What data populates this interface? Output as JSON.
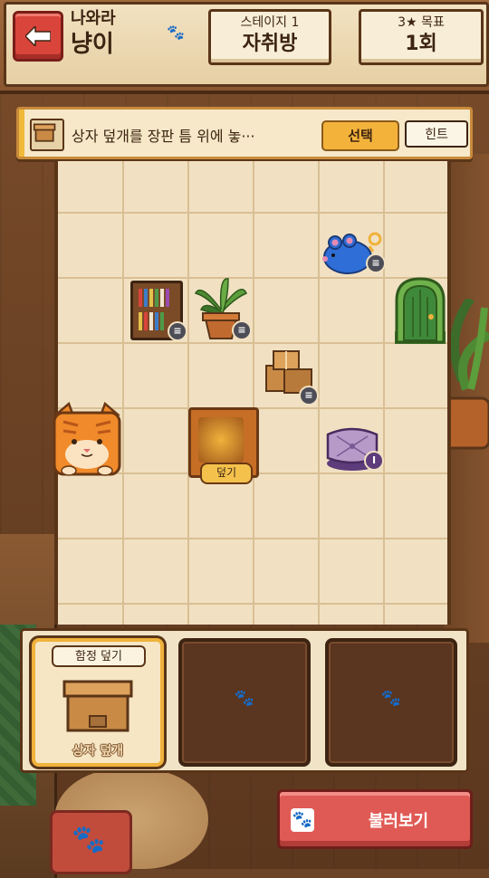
{
  "header": {
    "title_line1": "나와라",
    "title_line2": "냥이",
    "stage": {
      "label": "스테이지 1",
      "value": "자취방"
    },
    "goal": {
      "label": "3★ 목표",
      "value": "1회"
    }
  },
  "hint_bar": {
    "text": "상자 덮개를 장판 틈 위에 놓···",
    "select_label": "선택",
    "hint_label": "힌트"
  },
  "board": {
    "trap_label": "덮기",
    "badge_glyph": "≡",
    "cushion_badge_glyph": "I"
  },
  "inventory": {
    "slots": [
      {
        "title": "함정 덮기",
        "name": "상자 덮개",
        "state": "selected"
      },
      {
        "state": "empty"
      },
      {
        "state": "empty"
      }
    ],
    "empty_glyph": "🐾"
  },
  "load_button": {
    "label": "불러보기"
  },
  "colors": {
    "accent_red": "#d9443b",
    "accent_orange": "#f3b33b",
    "wood_dark": "#5a3518",
    "board_floor": "#f1e1c2"
  }
}
